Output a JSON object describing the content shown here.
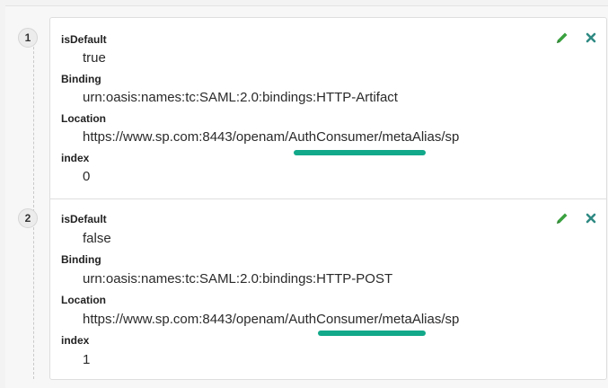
{
  "entries": [
    {
      "number": "1",
      "is_default_label": "isDefault",
      "is_default_value": "true",
      "binding_label": "Binding",
      "binding_value": "urn:oasis:names:tc:SAML:2.0:bindings:HTTP-Artifact",
      "location_label": "Location",
      "location_value": "https://www.sp.com:8443/openam/AuthConsumer/metaAlias/sp",
      "index_label": "index",
      "index_value": "0"
    },
    {
      "number": "2",
      "is_default_label": "isDefault",
      "is_default_value": "false",
      "binding_label": "Binding",
      "binding_value": "urn:oasis:names:tc:SAML:2.0:bindings:HTTP-POST",
      "location_label": "Location",
      "location_value": "https://www.sp.com:8443/openam/AuthConsumer/metaAlias/sp",
      "index_label": "index",
      "index_value": "1"
    }
  ],
  "icons": {
    "edit": "pencil-icon",
    "delete": "close-icon"
  },
  "colors": {
    "edit_icon": "#3aa13f",
    "delete_icon": "#2f8a83",
    "highlight": "#12a88a"
  }
}
